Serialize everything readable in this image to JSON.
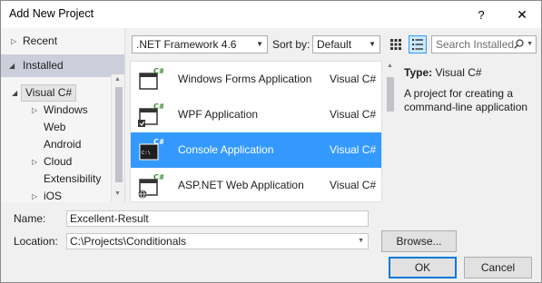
{
  "window": {
    "title": "Add New Project",
    "help_glyph": "?",
    "close_glyph": "✕"
  },
  "sidebar": {
    "recent": "Recent",
    "installed": "Installed",
    "items": [
      {
        "label": "Visual C#",
        "arrow": "◢"
      },
      {
        "label": "Windows",
        "arrow": "▷"
      },
      {
        "label": "Web",
        "arrow": ""
      },
      {
        "label": "Android",
        "arrow": ""
      },
      {
        "label": "Cloud",
        "arrow": "▷"
      },
      {
        "label": "Extensibility",
        "arrow": ""
      },
      {
        "label": "iOS",
        "arrow": "▷"
      }
    ]
  },
  "toolbar": {
    "framework": ".NET Framework 4.6",
    "sort_label": "Sort by:",
    "sort_value": "Default",
    "search_placeholder": "Search Installed"
  },
  "templates": [
    {
      "name": "Windows Forms Application",
      "lang": "Visual C#",
      "icon": "windows-forms-icon"
    },
    {
      "name": "WPF Application",
      "lang": "Visual C#",
      "icon": "wpf-icon"
    },
    {
      "name": "Console Application",
      "lang": "Visual C#",
      "icon": "console-icon",
      "selected": true
    },
    {
      "name": "ASP.NET Web Application",
      "lang": "Visual C#",
      "icon": "web-app-icon"
    }
  ],
  "info": {
    "type_label": "Type:",
    "type_value": "Visual C#",
    "description": "A project for creating a command-line application"
  },
  "form": {
    "name_label": "Name:",
    "name_value": "Excellent-Result",
    "location_label": "Location:",
    "location_value": "C:\\Projects\\Conditionals",
    "browse": "Browse...",
    "ok": "OK",
    "cancel": "Cancel"
  },
  "colors": {
    "selection": "#3399ff",
    "csharp_badge": "#388a34",
    "focus": "#0078d7"
  }
}
